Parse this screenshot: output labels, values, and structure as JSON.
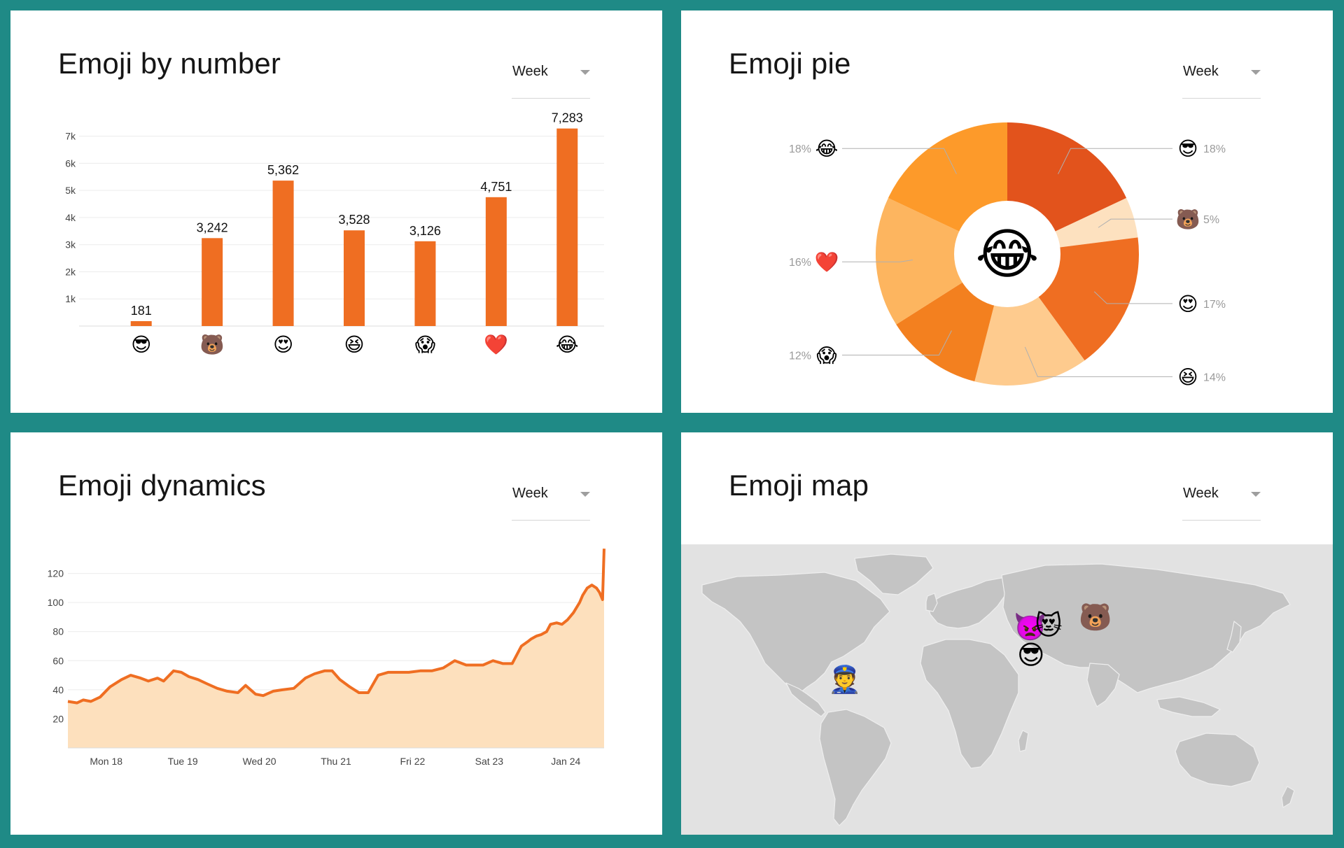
{
  "bar_card": {
    "title": "Emoji by number",
    "period": "Week"
  },
  "pie_card": {
    "title": "Emoji pie",
    "period": "Week"
  },
  "line_card": {
    "title": "Emoji dynamics",
    "period": "Week"
  },
  "map_card": {
    "title": "Emoji map",
    "period": "Week"
  },
  "chart_data": [
    {
      "type": "bar",
      "title": "Emoji by number",
      "categories": [
        "smiling face with sunglasses",
        "bear face",
        "smiling face with heart-eyes",
        "grinning squinting face",
        "face screaming in fear",
        "red heart",
        "face with tears of joy"
      ],
      "category_glyphs": [
        "😎",
        "🐻",
        "😍",
        "😆",
        "😱",
        "❤️",
        "😂"
      ],
      "values": [
        181,
        3242,
        5362,
        3528,
        3126,
        4751,
        7283
      ],
      "value_labels": [
        "181",
        "3,242",
        "5,362",
        "3,528",
        "3,126",
        "4,751",
        "7,283"
      ],
      "ytick_labels": [
        "1k",
        "2k",
        "3k",
        "4k",
        "5k",
        "6k",
        "7k"
      ],
      "ytick_values": [
        1000,
        2000,
        3000,
        4000,
        5000,
        6000,
        7000
      ],
      "ylim": [
        0,
        7300
      ],
      "grid": true,
      "color": "#ef6e22"
    },
    {
      "type": "pie",
      "title": "Emoji pie",
      "center_glyph": "😂",
      "slices": [
        {
          "emoji": "😎",
          "pct_label": "18%",
          "value": 18,
          "color": "#e2531c"
        },
        {
          "emoji": "🐻",
          "pct_label": "5%",
          "value": 5,
          "color": "#fde1bf"
        },
        {
          "emoji": "😍",
          "pct_label": "17%",
          "value": 17,
          "color": "#ef6e22"
        },
        {
          "emoji": "😆",
          "pct_label": "14%",
          "value": 14,
          "color": "#fecb8e"
        },
        {
          "emoji": "😱",
          "pct_label": "12%",
          "value": 12,
          "color": "#f3801f"
        },
        {
          "emoji": "❤️",
          "pct_label": "16%",
          "value": 16,
          "color": "#fdb55f"
        },
        {
          "emoji": "😂",
          "pct_label": "18%",
          "value": 18,
          "color": "#fd9a2a"
        }
      ]
    },
    {
      "type": "area",
      "title": "Emoji dynamics",
      "x_tick_labels": [
        "Mon 18",
        "Tue 19",
        "Wed 20",
        "Thu 21",
        "Fri 22",
        "Sat 23",
        "Jan 24"
      ],
      "ytick_values": [
        20,
        40,
        60,
        80,
        100,
        120
      ],
      "ytick_labels": [
        "20",
        "40",
        "60",
        "80",
        "100",
        "120"
      ],
      "xlim": [
        0,
        7
      ],
      "ylim": [
        0,
        140
      ],
      "grid": true,
      "line_color": "#ef6e22",
      "fill_color": "#fde0bd",
      "x": [
        0,
        0.12,
        0.2,
        0.3,
        0.42,
        0.55,
        0.7,
        0.82,
        0.95,
        1.05,
        1.17,
        1.25,
        1.38,
        1.48,
        1.58,
        1.7,
        1.82,
        1.95,
        2.08,
        2.22,
        2.32,
        2.45,
        2.55,
        2.68,
        2.8,
        2.95,
        3.1,
        3.22,
        3.35,
        3.45,
        3.55,
        3.68,
        3.8,
        3.92,
        4.05,
        4.18,
        4.3,
        4.45,
        4.6,
        4.75,
        4.9,
        5.05,
        5.2,
        5.3,
        5.42,
        5.55,
        5.68,
        5.8,
        5.92,
        6.0,
        6.05,
        6.12,
        6.18,
        6.25,
        6.3,
        6.38,
        6.45,
        6.52,
        6.6,
        6.68,
        6.72,
        6.78,
        6.84,
        6.9,
        6.94,
        6.98,
        7.0
      ],
      "values": [
        32,
        31,
        33,
        32,
        35,
        42,
        47,
        50,
        48,
        46,
        48,
        46,
        53,
        52,
        49,
        47,
        44,
        41,
        39,
        38,
        43,
        37,
        36,
        39,
        40,
        41,
        48,
        51,
        53,
        53,
        47,
        42,
        38,
        38,
        50,
        52,
        52,
        52,
        53,
        53,
        55,
        60,
        57,
        57,
        57,
        60,
        58,
        58,
        70,
        73,
        75,
        77,
        78,
        80,
        85,
        86,
        85,
        88,
        93,
        100,
        105,
        110,
        112,
        110,
        107,
        102,
        137
      ]
    }
  ],
  "map_markers": [
    {
      "emoji": "👮",
      "name": "police-officer"
    },
    {
      "emoji": "👿",
      "name": "angry-devil"
    },
    {
      "emoji": "😻",
      "name": "heart-eyes-cat"
    },
    {
      "emoji": "🐻",
      "name": "bear"
    },
    {
      "emoji": "😎",
      "name": "sunglasses-face"
    }
  ]
}
